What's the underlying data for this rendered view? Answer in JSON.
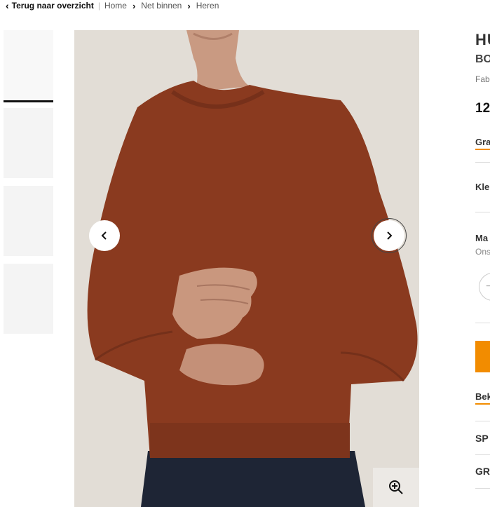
{
  "breadcrumb": {
    "back_label": "Terug naar overzicht",
    "items": [
      "Home",
      "Net binnen",
      "Heren"
    ]
  },
  "gallery": {
    "thumbnail_count": 4,
    "active_index": 0,
    "prev_icon": "chevron-left-icon",
    "next_icon": "chevron-right-icon",
    "zoom_icon": "zoom-in-icon"
  },
  "product": {
    "brand": "HU",
    "name": "BO",
    "subtitle": "Fab",
    "price": "12",
    "tab_label": "Gra",
    "color_label": "Kle",
    "size_label": "Ma",
    "size_note": "Ons",
    "quantity_icon": "minus-icon",
    "info_tab": "Bek",
    "section_1": "SP",
    "section_2": "GR"
  },
  "colors": {
    "accent": "#f28c00",
    "sweater": "#8a3a1f",
    "background_photo": "#e3ded7"
  }
}
